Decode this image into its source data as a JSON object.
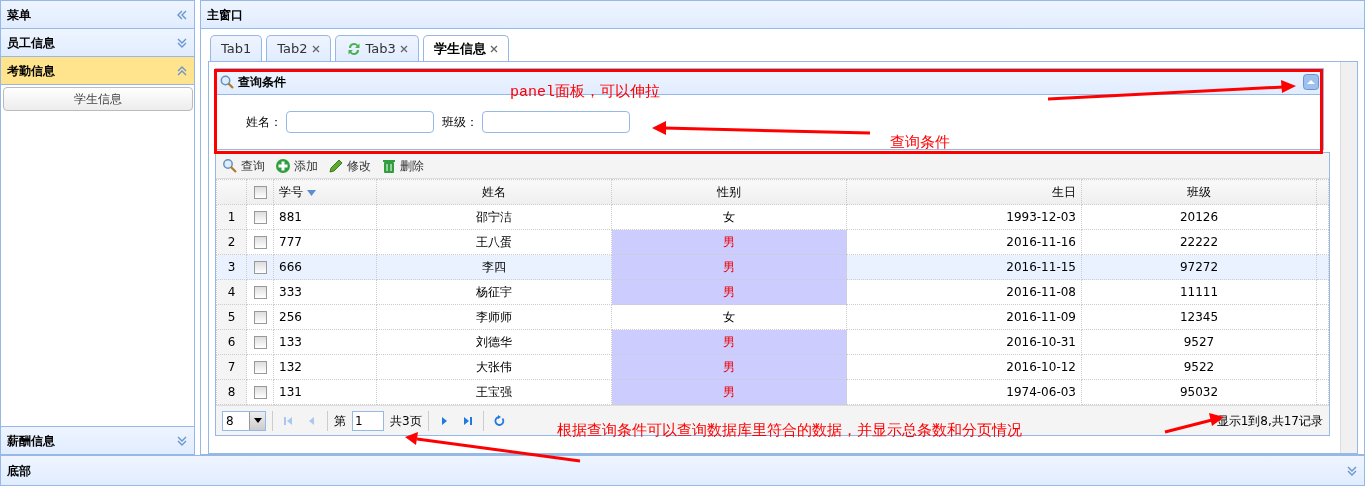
{
  "sidebar": {
    "title": "菜单",
    "sections": [
      {
        "title": "员工信息",
        "expanded": false
      },
      {
        "title": "考勤信息",
        "expanded": true,
        "items": [
          "学生信息"
        ]
      },
      {
        "title": "薪酬信息",
        "expanded": false
      }
    ]
  },
  "main": {
    "title": "主窗口"
  },
  "tabs": [
    {
      "label": "Tab1",
      "closable": false,
      "refresh_icon": false,
      "selected": false
    },
    {
      "label": "Tab2",
      "closable": true,
      "refresh_icon": false,
      "selected": false
    },
    {
      "label": "Tab3",
      "closable": true,
      "refresh_icon": true,
      "selected": false
    },
    {
      "label": "学生信息",
      "closable": true,
      "refresh_icon": false,
      "selected": true
    }
  ],
  "query_panel": {
    "title": "查询条件",
    "expanded": true,
    "fields": [
      {
        "label": "姓名："
      },
      {
        "label": "班级："
      }
    ]
  },
  "toolbar": [
    {
      "label": "查询",
      "kind": "search"
    },
    {
      "label": "添加",
      "kind": "add"
    },
    {
      "label": "修改",
      "kind": "edit"
    },
    {
      "label": "删除",
      "kind": "delete"
    }
  ],
  "table": {
    "all_checked": false,
    "columns": [
      {
        "label": "学号",
        "sorted": true
      },
      {
        "label": "姓名",
        "sorted": false
      },
      {
        "label": "性别",
        "sorted": false
      },
      {
        "label": "生日",
        "sorted": false
      },
      {
        "label": "班级",
        "sorted": false
      }
    ],
    "rows": [
      {
        "index": "1",
        "checked": false,
        "selected": false,
        "id": "881",
        "name": "邵宁洁",
        "gender": "女",
        "gender_highlight": false,
        "birthday": "1993-12-03",
        "class": "20126"
      },
      {
        "index": "2",
        "checked": false,
        "selected": false,
        "id": "777",
        "name": "王八蛋",
        "gender": "男",
        "gender_highlight": true,
        "birthday": "2016-11-16",
        "class": "22222"
      },
      {
        "index": "3",
        "checked": false,
        "selected": true,
        "id": "666",
        "name": "李四",
        "gender": "男",
        "gender_highlight": true,
        "birthday": "2016-11-15",
        "class": "97272"
      },
      {
        "index": "4",
        "checked": false,
        "selected": false,
        "id": "333",
        "name": "杨征宇",
        "gender": "男",
        "gender_highlight": true,
        "birthday": "2016-11-08",
        "class": "11111"
      },
      {
        "index": "5",
        "checked": false,
        "selected": false,
        "id": "256",
        "name": "李师师",
        "gender": "女",
        "gender_highlight": false,
        "birthday": "2016-11-09",
        "class": "12345"
      },
      {
        "index": "6",
        "checked": false,
        "selected": false,
        "id": "133",
        "name": "刘德华",
        "gender": "男",
        "gender_highlight": true,
        "birthday": "2016-10-31",
        "class": "9527"
      },
      {
        "index": "7",
        "checked": false,
        "selected": false,
        "id": "132",
        "name": "大张伟",
        "gender": "男",
        "gender_highlight": true,
        "birthday": "2016-10-12",
        "class": "9522"
      },
      {
        "index": "8",
        "checked": false,
        "selected": false,
        "id": "131",
        "name": "王宝强",
        "gender": "男",
        "gender_highlight": true,
        "birthday": "1974-06-03",
        "class": "95032"
      }
    ]
  },
  "pager": {
    "page_size": "8",
    "page_label": "第",
    "page": "1",
    "page_total": "共3页",
    "info": "显示1到8,共17记录"
  },
  "annotations": [
    "panel面板，可以伸拉",
    "查询条件",
    "根据查询条件可以查询数据库里符合的数据，并显示总条数和分页情况"
  ],
  "footer": {
    "title": "底部"
  }
}
